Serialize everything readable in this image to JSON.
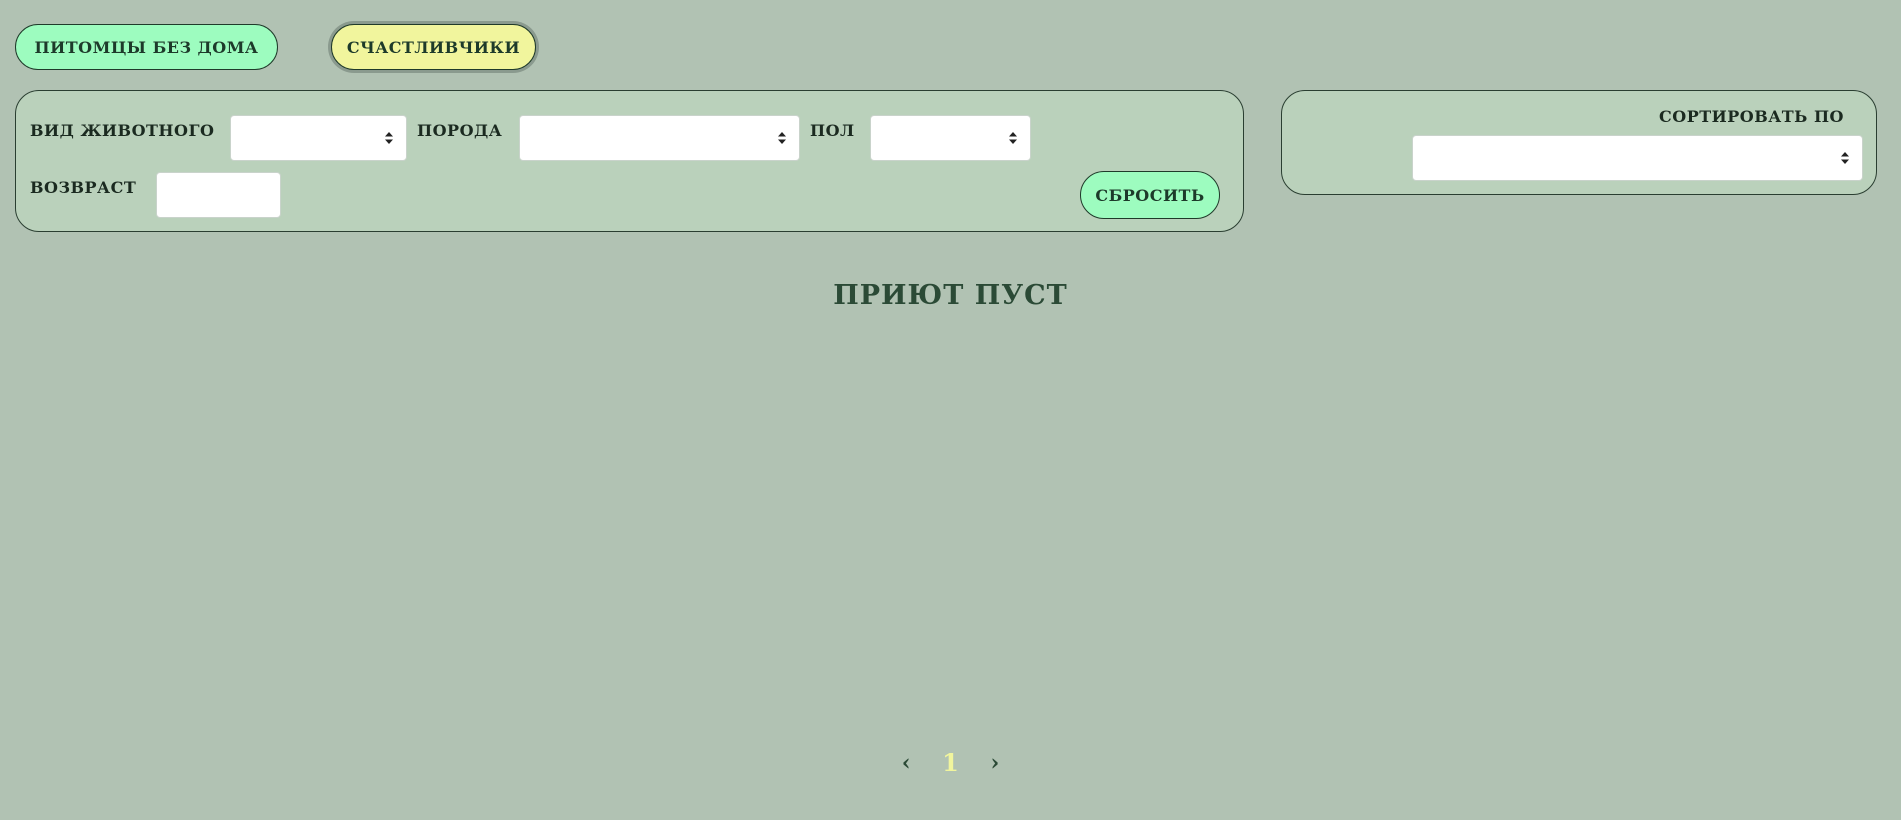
{
  "tabs": {
    "homeless_label": "питомцы без дома",
    "lucky_label": "счастливчики"
  },
  "filters": {
    "animal_type_label": "вид животного",
    "animal_type_value": "",
    "breed_label": "порода",
    "breed_value": "",
    "sex_label": "пол",
    "sex_value": "",
    "age_label": "возвраст",
    "age_value": "",
    "reset_label": "сбросить"
  },
  "sort": {
    "label": "сортировать по",
    "value": ""
  },
  "main": {
    "empty_message": "приют пуст"
  },
  "pagination": {
    "prev": "‹",
    "current_page": "1",
    "next": "›"
  },
  "colors": {
    "background": "#b1c2b3",
    "panel": "#bad1bb",
    "accent_green": "#9dfcbf",
    "accent_yellow": "#f1f59d",
    "text_dark": "#2b4a36"
  },
  "icons": {
    "select_arrows": "up-down-arrows-icon",
    "prev": "chevron-left-icon",
    "next": "chevron-right-icon"
  }
}
